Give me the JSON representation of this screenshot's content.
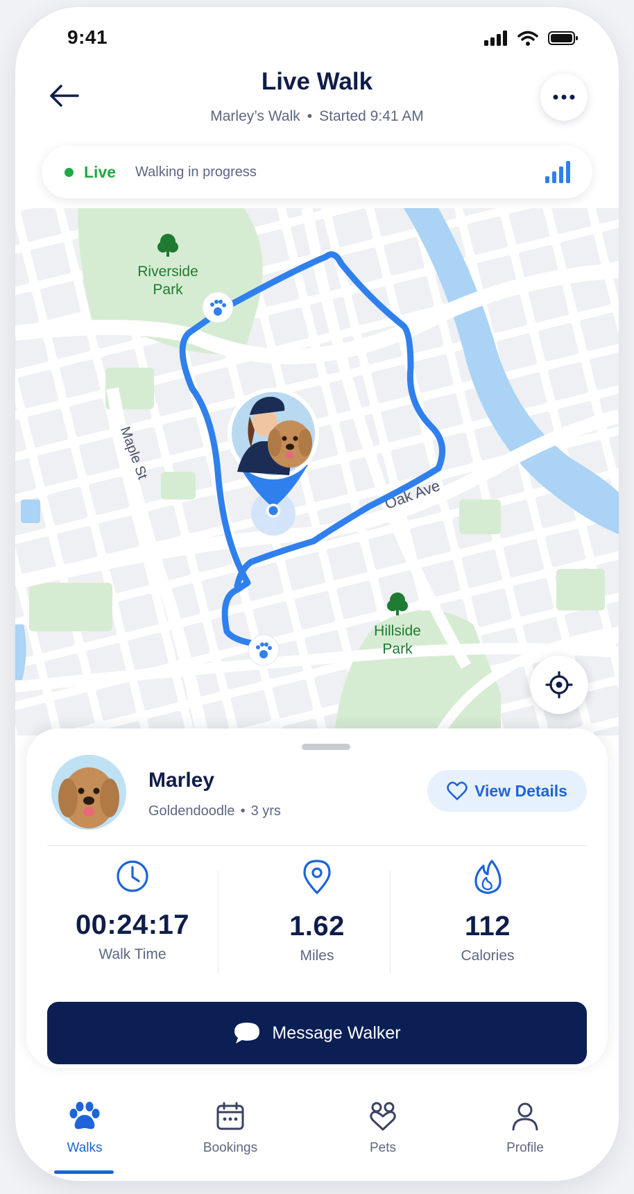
{
  "status_bar": {
    "time": "9:41"
  },
  "header": {
    "title": "Live Walk",
    "subtitle_name": "Marley’s Walk",
    "subtitle_separator": "•",
    "subtitle_started": "Started 9:41 AM"
  },
  "live": {
    "label": "Live",
    "text": "Walking in progress",
    "status_color": "#1fa843"
  },
  "map": {
    "parks": [
      "Riverside Park",
      "Hillside Park"
    ],
    "streets": [
      "Maple St",
      "Oak Ave"
    ],
    "route_color": "#2f80ed",
    "water_color": "#aad3f5"
  },
  "pet": {
    "name": "Marley",
    "breed": "Goldendoodle",
    "separator": "•",
    "age": "3 yrs",
    "view_details_label": "View Details"
  },
  "stats": [
    {
      "icon": "clock-icon",
      "value": "00:24:17",
      "label": "Walk Time"
    },
    {
      "icon": "location-pin-icon",
      "value": "1.62",
      "label": "Miles"
    },
    {
      "icon": "flame-icon",
      "value": "112",
      "label": "Calories"
    }
  ],
  "actions": {
    "message_label": "Message Walker"
  },
  "tabs": [
    {
      "label": "Walks",
      "icon": "paw-icon",
      "active": true
    },
    {
      "label": "Bookings",
      "icon": "calendar-icon",
      "active": false
    },
    {
      "label": "Pets",
      "icon": "pets-heart-icon",
      "active": false
    },
    {
      "label": "Profile",
      "icon": "person-icon",
      "active": false
    }
  ],
  "colors": {
    "accent": "#1d64d8",
    "navy": "#0b1f55",
    "text": "#0f1d4a",
    "muted": "#5d6682"
  }
}
